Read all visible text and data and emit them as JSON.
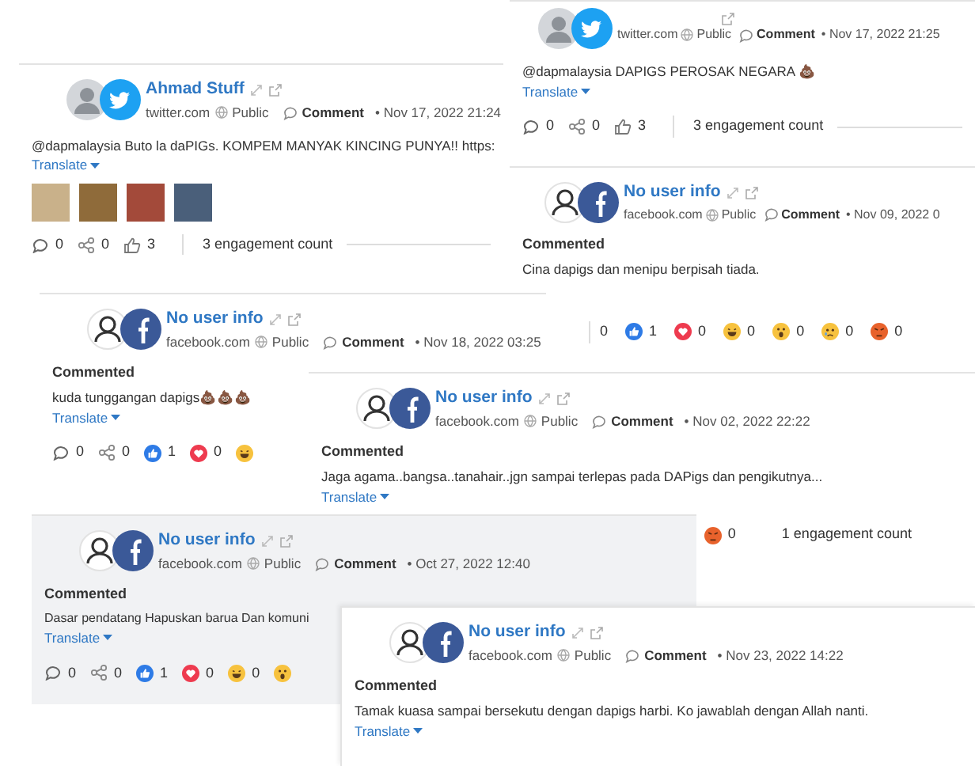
{
  "cards": [
    {
      "kind": "twitter",
      "highlighted": false,
      "name": "Ahmad Stuff",
      "source": "twitter.com",
      "visibility": "Public",
      "action": "Comment",
      "date": "• Nov 17, 2022 21:24",
      "text": "@dapmalaysia Buto la daPIGs. KOMPEM MANYAK KINCING PUNYA!! https:",
      "translate": "Translate",
      "attachments": [
        {
          "kind": "image"
        },
        {
          "kind": "image"
        },
        {
          "kind": "image"
        },
        {
          "kind": "image"
        }
      ],
      "stats": [
        {
          "kind": "comment",
          "count": "0"
        },
        {
          "kind": "share",
          "count": "0"
        },
        {
          "kind": "thumb",
          "count": "3"
        }
      ],
      "engagement": "3 engagement count"
    },
    {
      "kind": "twitter",
      "highlighted": false,
      "source": "twitter.com",
      "visibility": "Public",
      "action": "Comment",
      "date": "• Nov 17, 2022 21:25",
      "text": "@dapmalaysia DAPIGS PEROSAK NEGARA 💩",
      "translate": "Translate",
      "stats": [
        {
          "kind": "comment",
          "count": "0"
        },
        {
          "kind": "share",
          "count": "0"
        },
        {
          "kind": "thumb",
          "count": "3"
        }
      ],
      "engagement": "3 engagement count"
    },
    {
      "kind": "facebook",
      "highlighted": false,
      "name": "No user info",
      "source": "facebook.com",
      "visibility": "Public",
      "action": "Comment",
      "date": "• Nov 09, 2022 0",
      "label": "Commented",
      "text": "Cina dapigs dan menipu berpisah tiada."
    },
    {
      "kind": "facebook",
      "highlighted": false,
      "name": "No user info",
      "source": "facebook.com",
      "visibility": "Public",
      "action": "Comment",
      "date": "• Nov 18, 2022 03:25",
      "label": "Commented",
      "text": "kuda tunggangan dapigs💩💩💩",
      "translate": "Translate",
      "stats": [
        {
          "kind": "comment",
          "count": "0"
        },
        {
          "kind": "share",
          "count": "0"
        },
        {
          "kind": "like",
          "count": "1"
        },
        {
          "kind": "love",
          "count": "0"
        },
        {
          "kind": "haha"
        }
      ]
    },
    {
      "kind": "facebook",
      "highlighted": false,
      "name": "No user info",
      "source": "facebook.com",
      "visibility": "Public",
      "action": "Comment",
      "date": "• Nov 02, 2022 22:22",
      "label": "Commented",
      "text": "Jaga agama..bangsa..tanahair..jgn sampai terlepas pada DAPigs dan pengikutnya...",
      "translate": "Translate",
      "footer_stats": [
        {
          "kind": "angry",
          "count": "0"
        }
      ],
      "engagement": "1 engagement count"
    },
    {
      "kind": "facebook",
      "highlighted": true,
      "name": "No user info",
      "source": "facebook.com",
      "visibility": "Public",
      "action": "Comment",
      "date": "• Oct 27, 2022 12:40",
      "label": "Commented",
      "text": "Dasar pendatang Hapuskan barua Dan komuni",
      "translate": "Translate",
      "stats": [
        {
          "kind": "comment",
          "count": "0"
        },
        {
          "kind": "share",
          "count": "0"
        },
        {
          "kind": "like",
          "count": "1"
        },
        {
          "kind": "love",
          "count": "0"
        },
        {
          "kind": "haha",
          "count": "0"
        },
        {
          "kind": "wow"
        }
      ]
    },
    {
      "kind": "facebook",
      "highlighted": false,
      "name": "No user info",
      "source": "facebook.com",
      "visibility": "Public",
      "action": "Comment",
      "date": "• Nov 23, 2022 14:22",
      "label": "Commented",
      "text": "Tamak kuasa sampai bersekutu dengan dapigs harbi. Ko jawablah dengan Allah nanti.",
      "translate": "Translate"
    }
  ],
  "reaction_strip": {
    "stats": [
      {
        "kind": "plain",
        "count": "0"
      },
      {
        "kind": "like",
        "count": "1"
      },
      {
        "kind": "love",
        "count": "0"
      },
      {
        "kind": "haha",
        "count": "0"
      },
      {
        "kind": "wow",
        "count": "0"
      },
      {
        "kind": "sad",
        "count": "0"
      },
      {
        "kind": "angry",
        "count": "0"
      }
    ]
  }
}
